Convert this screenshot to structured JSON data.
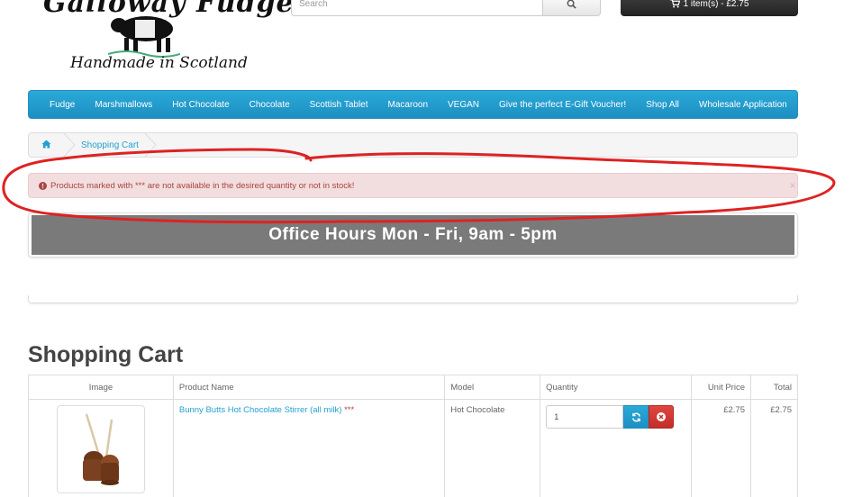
{
  "logo": {
    "title": "Galloway Fudge",
    "subtitle": "Handmade in Scotland"
  },
  "search": {
    "placeholder": "Search",
    "icon": "search-icon"
  },
  "cart_summary": {
    "label": "1 item(s) - £2.75",
    "icon": "shopping-cart-icon"
  },
  "nav": {
    "items": [
      "Fudge",
      "Marshmallows",
      "Hot Chocolate",
      "Chocolate",
      "Scottish Tablet",
      "Macaroon",
      "VEGAN",
      "Give the perfect E-Gift Voucher!",
      "Shop All",
      "Wholesale Application"
    ],
    "color": "#23a1d1"
  },
  "breadcrumb": {
    "home_icon": "home-icon",
    "current": "Shopping Cart"
  },
  "alert": {
    "icon": "exclamation-circle-icon",
    "message": "Products marked with *** are not available in the desired quantity or not in stock!",
    "close": "×",
    "bg": "#f2dede",
    "text_color": "#a94442"
  },
  "banner": {
    "text": "Office Hours Mon - Fri, 9am - 5pm"
  },
  "page": {
    "title": "Shopping Cart"
  },
  "cart_table": {
    "headers": {
      "image": "Image",
      "name": "Product Name",
      "model": "Model",
      "quantity": "Quantity",
      "unit_price": "Unit Price",
      "total": "Total"
    },
    "rows": [
      {
        "name": "Bunny Butts Hot Chocolate Stirrer (all milk)",
        "stock_flag": "***",
        "model": "Hot Chocolate",
        "quantity": "1",
        "unit_price": "£2.75",
        "total": "£2.75"
      }
    ]
  },
  "annotation": {
    "color": "#dd2222"
  }
}
